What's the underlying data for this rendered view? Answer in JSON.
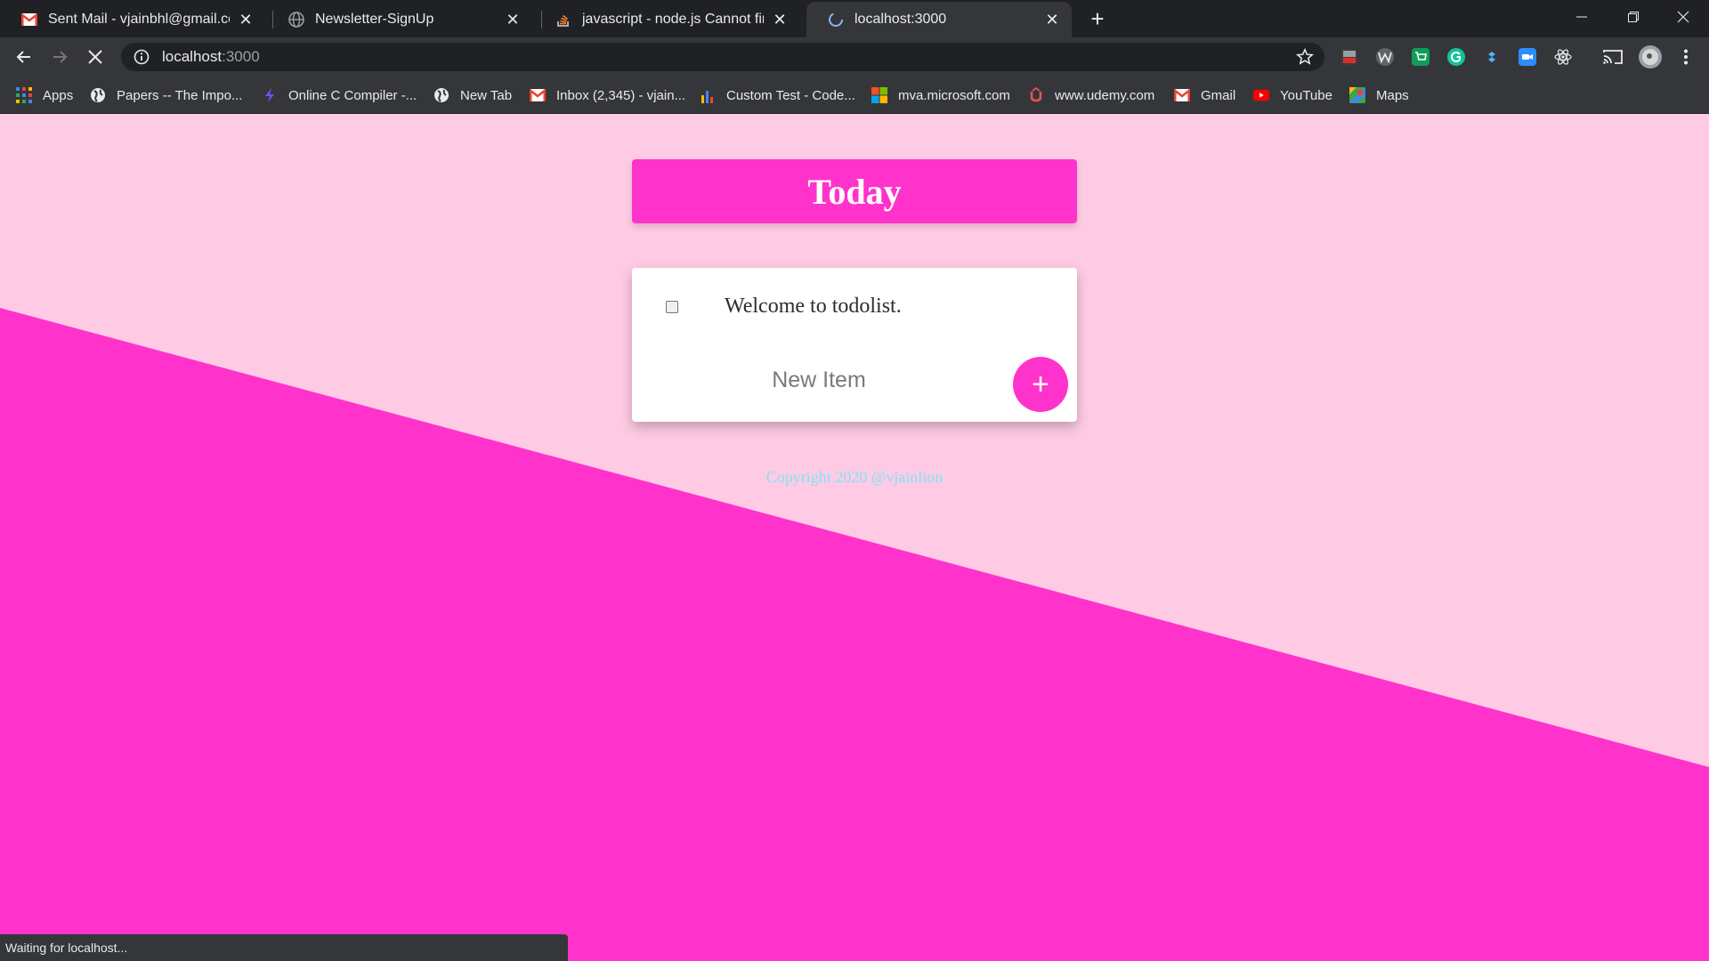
{
  "browser": {
    "tabs": [
      {
        "title": "Sent Mail - vjainbhl@gmail.com",
        "icon": "gmail-icon"
      },
      {
        "title": "Newsletter-SignUp",
        "icon": "globe-icon"
      },
      {
        "title": "javascript - node.js Cannot find m",
        "icon": "stackoverflow-icon"
      },
      {
        "title": "localhost:3000",
        "icon": "loading-icon",
        "active": true
      }
    ],
    "address": {
      "host": "localhost",
      "port": ":3000"
    },
    "bookmarks": [
      {
        "label": "Apps",
        "icon": "apps-grid-icon"
      },
      {
        "label": "Papers -- The Impo...",
        "icon": "globe-icon"
      },
      {
        "label": "Online C Compiler -...",
        "icon": "bolt-icon"
      },
      {
        "label": "New Tab",
        "icon": "globe-icon"
      },
      {
        "label": "Inbox (2,345) - vjain...",
        "icon": "gmail-icon"
      },
      {
        "label": "Custom Test - Code...",
        "icon": "bar-chart-icon"
      },
      {
        "label": "mva.microsoft.com",
        "icon": "microsoft-icon"
      },
      {
        "label": "www.udemy.com",
        "icon": "udemy-icon"
      },
      {
        "label": "Gmail",
        "icon": "gmail-icon"
      },
      {
        "label": "YouTube",
        "icon": "youtube-icon"
      },
      {
        "label": "Maps",
        "icon": "maps-icon"
      }
    ],
    "status": "Waiting for localhost..."
  },
  "page": {
    "heading": "Today",
    "items": [
      {
        "text": "Welcome to todolist.",
        "checked": false
      }
    ],
    "new_item_placeholder": "New Item",
    "add_button_label": "+",
    "footer": "Copyright 2020 @vjainlion"
  },
  "colors": {
    "accent": "#ff33cc",
    "background": "#ffcbe4",
    "footer_text": "#7fe3f7"
  }
}
